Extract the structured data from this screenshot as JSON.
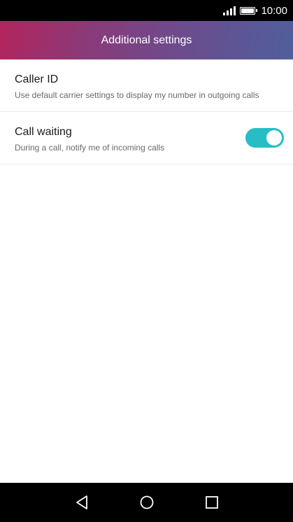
{
  "status_bar": {
    "time": "10:00",
    "battery_level": 1.0,
    "signal_level": 4
  },
  "header": {
    "title": "Additional settings"
  },
  "settings": [
    {
      "title": "Caller ID",
      "subtitle": "Use default carrier settings to display my number in outgoing calls"
    },
    {
      "title": "Call waiting",
      "subtitle": "During a call, notify me of incoming calls",
      "toggle_on": true
    }
  ],
  "nav_bar": {
    "buttons": [
      "back-icon",
      "home-icon",
      "recent-apps-icon"
    ]
  },
  "colors": {
    "accent": "#26bdc4",
    "header_start": "#b3245d",
    "header_end": "#4f5f9b"
  }
}
